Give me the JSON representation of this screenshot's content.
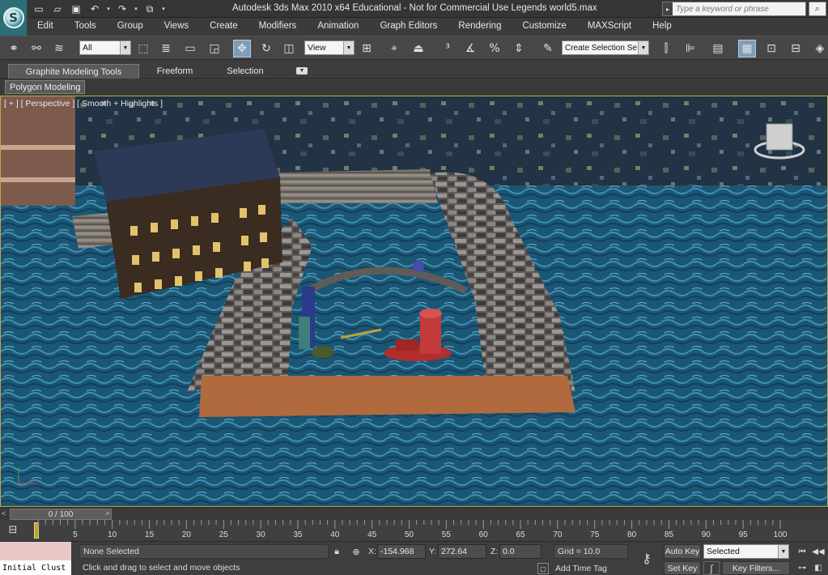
{
  "titlebar": {
    "title": "Autodesk 3ds Max  2010 x64   Educational - Not for Commercial Use     Legends world5.max",
    "search_placeholder": "Type a keyword or phrase",
    "logo_glyph": "S"
  },
  "menu": {
    "items": [
      "Edit",
      "Tools",
      "Group",
      "Views",
      "Create",
      "Modifiers",
      "Animation",
      "Graph Editors",
      "Rendering",
      "Customize",
      "MAXScript",
      "Help"
    ]
  },
  "toolbar": {
    "selection_filter": "All",
    "reference_coord": "View",
    "named_selection": "Create Selection Se"
  },
  "ribbon": {
    "tabs": [
      "Graphite Modeling Tools",
      "Freeform",
      "Selection"
    ],
    "active_tab": "Graphite Modeling Tools",
    "sub_tab": "Polygon Modeling"
  },
  "viewport": {
    "label": "[ + ] [ Perspective ] [ Smooth + Highlights ]",
    "colors": {
      "water": "#1e5a78",
      "stone": "#6d6a68",
      "wood": "#b06a3e",
      "sky": "#1f3346"
    }
  },
  "timeline": {
    "slider_label": "0 / 100",
    "ticks": [
      "5",
      "10",
      "15",
      "20",
      "25",
      "30",
      "35",
      "40",
      "45",
      "50",
      "55",
      "60",
      "65",
      "70",
      "75",
      "80",
      "85",
      "90",
      "95",
      "100"
    ]
  },
  "status": {
    "maxscript_text": "Initial Clust",
    "selection": "None Selected",
    "prompt": "Click and drag to select and move objects",
    "x_label": "X:",
    "x_value": "-154.968",
    "y_label": "Y:",
    "y_value": "272.64",
    "z_label": "Z:",
    "z_value": "0.0",
    "grid": "Grid = 10.0",
    "add_time_tag": "Add Time Tag",
    "auto_key": "Auto Key",
    "set_key": "Set Key",
    "key_mode": "Selected",
    "key_filters": "Key Filters..."
  }
}
